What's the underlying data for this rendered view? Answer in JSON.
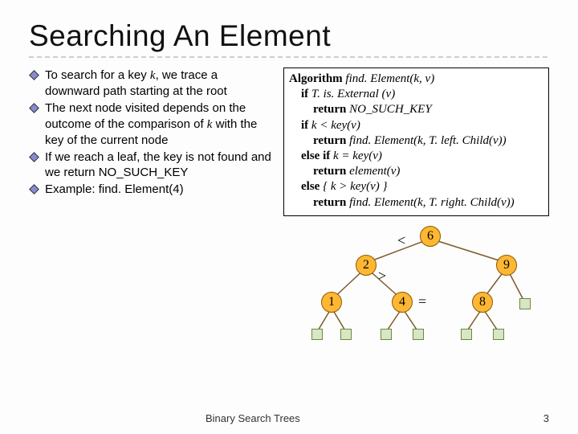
{
  "title": "Searching An Element",
  "bullets": [
    {
      "pre": "To search for a key ",
      "ital": "k",
      "post": ", we trace a downward path starting at the root"
    },
    {
      "pre": "The next node visited depends on the outcome of the comparison of ",
      "ital": "k",
      "post": " with the key of the current node"
    },
    {
      "pre": "If we reach a leaf, the key is not found and we return NO_SUCH_KEY",
      "ital": "",
      "post": ""
    },
    {
      "pre": "Example: find. Element(4)",
      "ital": "",
      "post": ""
    }
  ],
  "algo": {
    "l1": {
      "kw": "Algorithm",
      "fn": " find. Element",
      "args": "(k, v)"
    },
    "l2": {
      "kw": "if ",
      "expr": "T. is. External (v)"
    },
    "l3": {
      "kw": "return ",
      "expr": "NO_SUCH_KEY"
    },
    "l4": {
      "kw": "if ",
      "expr": "k < key(v)"
    },
    "l5": {
      "kw": "return",
      "fn": " find. Element",
      "args": "(k, T. left. Child(v))"
    },
    "l6": {
      "kw": "else if ",
      "expr": "k = key(v)"
    },
    "l7": {
      "kw": "return ",
      "fn": "element",
      "args": "(v)"
    },
    "l8": {
      "kw": "else ",
      "expr": "{ k > key(v) }"
    },
    "l9": {
      "kw": "return",
      "fn": " find. Element",
      "args": "(k, T. right. Child(v))"
    }
  },
  "tree": {
    "n6": "6",
    "n2": "2",
    "n9": "9",
    "n1": "1",
    "n4": "4",
    "n8": "8",
    "op_lt": "<",
    "op_gt": ">",
    "op_eq": "="
  },
  "footer": {
    "title": "Binary Search Trees",
    "page": "3"
  }
}
